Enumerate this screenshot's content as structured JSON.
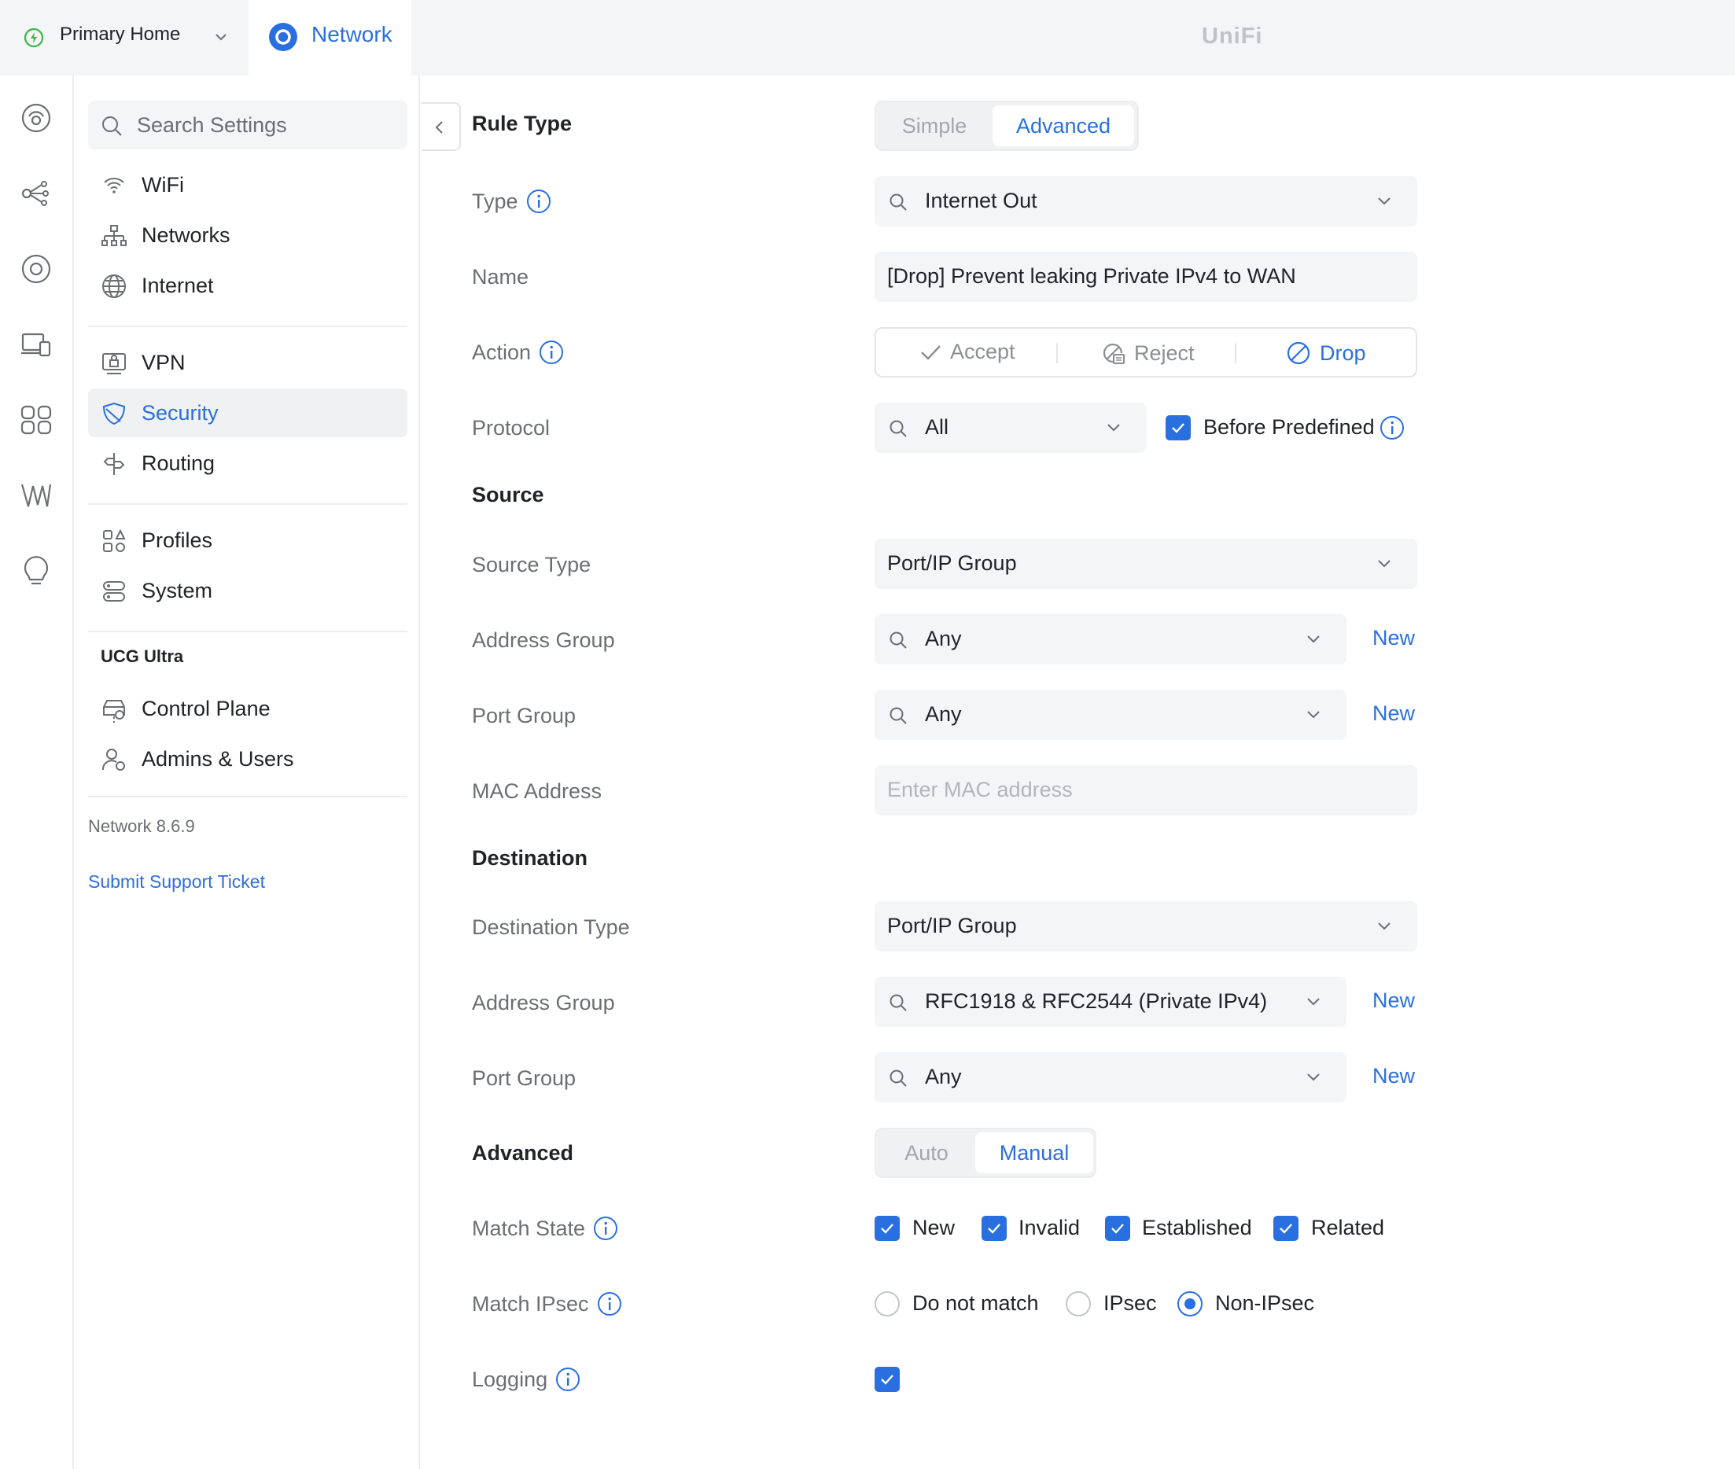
{
  "topbar": {
    "site_name": "Primary Home",
    "app_tab": "Network",
    "brand": "UniFi"
  },
  "rail": {
    "icons": [
      "dashboard-icon",
      "topology-icon",
      "devices-icon",
      "clients-icon",
      "insights-icon",
      "radio-manager-icon",
      "alerts-icon"
    ]
  },
  "sidebar": {
    "search_placeholder": "Search Settings",
    "items": [
      {
        "label": "WiFi",
        "icon": "wifi-icon"
      },
      {
        "label": "Networks",
        "icon": "networks-icon"
      },
      {
        "label": "Internet",
        "icon": "globe-icon"
      },
      {
        "label": "VPN",
        "icon": "vpn-icon"
      },
      {
        "label": "Security",
        "icon": "shield-icon",
        "active": true
      },
      {
        "label": "Routing",
        "icon": "routing-icon"
      },
      {
        "label": "Profiles",
        "icon": "profiles-icon"
      },
      {
        "label": "System",
        "icon": "system-icon"
      },
      {
        "label": "Control Plane",
        "icon": "control-plane-icon"
      },
      {
        "label": "Admins & Users",
        "icon": "admins-icon"
      }
    ],
    "section_device": "UCG Ultra",
    "version": "Network 8.6.9",
    "support_link": "Submit Support Ticket"
  },
  "form": {
    "rule_type": {
      "label": "Rule Type",
      "options": [
        "Simple",
        "Advanced"
      ],
      "selected": "Advanced"
    },
    "type": {
      "label": "Type",
      "value": "Internet Out"
    },
    "name": {
      "label": "Name",
      "value": "[Drop] Prevent leaking Private IPv4 to WAN"
    },
    "action": {
      "label": "Action",
      "options": [
        "Accept",
        "Reject",
        "Drop"
      ],
      "selected": "Drop"
    },
    "protocol": {
      "label": "Protocol",
      "value": "All",
      "before_predefined_label": "Before Predefined",
      "before_predefined_checked": true
    },
    "source": {
      "heading": "Source",
      "type_label": "Source Type",
      "type_value": "Port/IP Group",
      "address_group_label": "Address Group",
      "address_group_value": "Any",
      "port_group_label": "Port Group",
      "port_group_value": "Any",
      "mac_label": "MAC Address",
      "mac_placeholder": "Enter MAC address"
    },
    "destination": {
      "heading": "Destination",
      "type_label": "Destination Type",
      "type_value": "Port/IP Group",
      "address_group_label": "Address Group",
      "address_group_value": "RFC1918 & RFC2544 (Private IPv4)",
      "port_group_label": "Port Group",
      "port_group_value": "Any"
    },
    "new_link": "New",
    "advanced": {
      "heading": "Advanced",
      "options": [
        "Auto",
        "Manual"
      ],
      "selected": "Manual"
    },
    "match_state": {
      "label": "Match State",
      "options": [
        "New",
        "Invalid",
        "Established",
        "Related"
      ],
      "checked": [
        true,
        true,
        true,
        true
      ]
    },
    "match_ipsec": {
      "label": "Match IPsec",
      "options": [
        "Do not match",
        "IPsec",
        "Non-IPsec"
      ],
      "selected": "Non-IPsec"
    },
    "logging": {
      "label": "Logging",
      "checked": true
    }
  },
  "colors": {
    "accent": "#2a6fe0",
    "muted_text": "#6b6e73",
    "field_bg": "#f4f5f6"
  }
}
